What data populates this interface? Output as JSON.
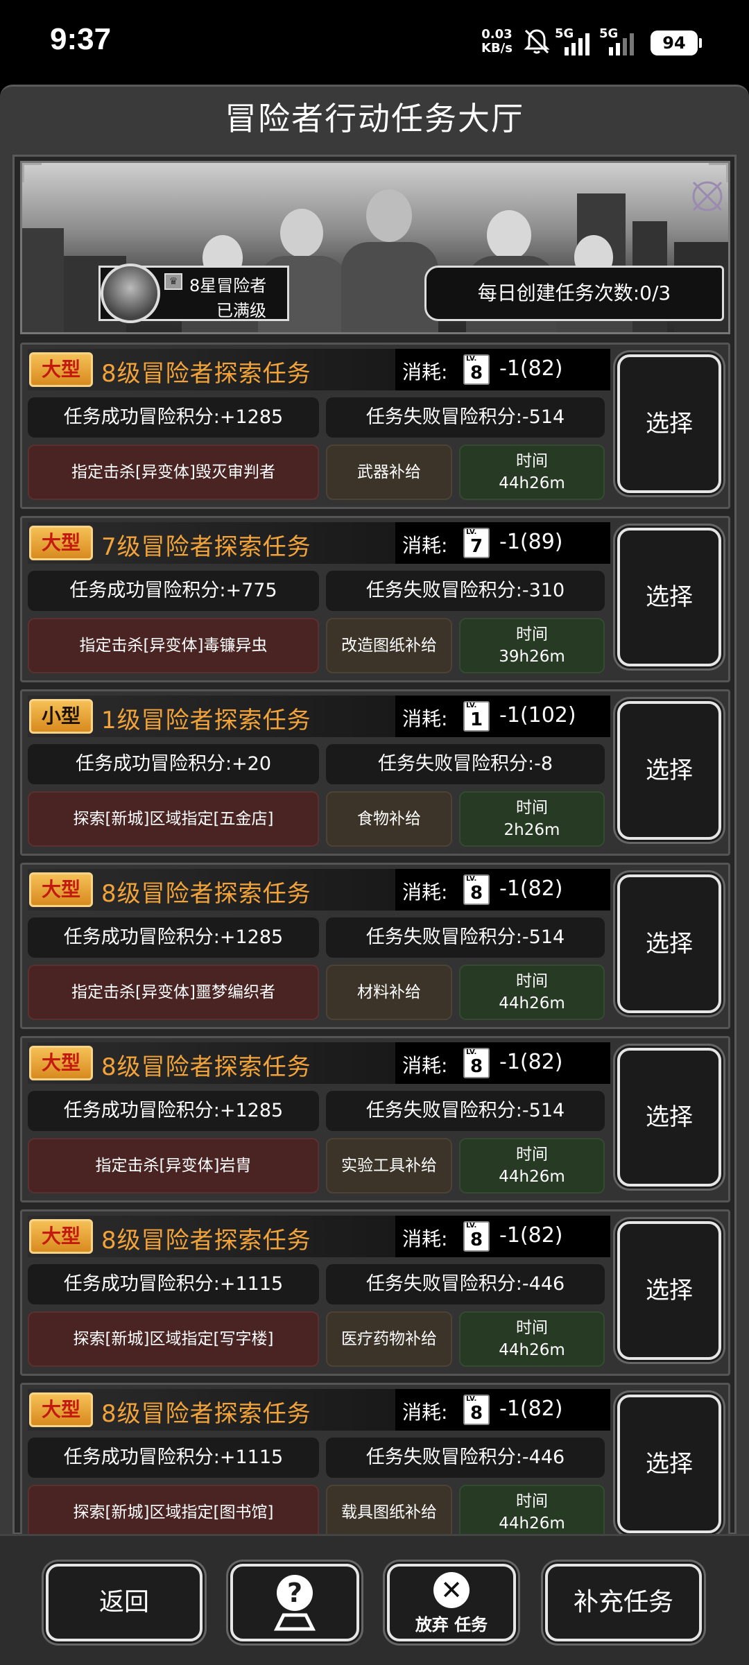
{
  "status_bar": {
    "time": "9:37",
    "speed_value": "0.03",
    "speed_unit": "KB/s",
    "signal1_label": "5G",
    "signal2_label": "5G",
    "battery": "94"
  },
  "panel": {
    "title": "冒险者行动任务大厅"
  },
  "banner": {
    "rank_title": "8星冒险者",
    "rank_status": "已满级",
    "daily_quota": "每日创建任务次数:0/3"
  },
  "common": {
    "cost_label": "消耗:",
    "lv_text": "LV.",
    "time_label": "时间",
    "select_label": "选择"
  },
  "missions": [
    {
      "type": "大型",
      "title": "8级冒险者探索任务",
      "lv": "8",
      "cost": "-1(82)",
      "success": "任务成功冒险积分:+1285",
      "fail": "任务失败冒险积分:-514",
      "target": "指定击杀[异变体]毁灭审判者",
      "supply": "武器补给",
      "time": "44h26m"
    },
    {
      "type": "大型",
      "title": "7级冒险者探索任务",
      "lv": "7",
      "cost": "-1(89)",
      "success": "任务成功冒险积分:+775",
      "fail": "任务失败冒险积分:-310",
      "target": "指定击杀[异变体]毒镰异虫",
      "supply": "改造图纸补给",
      "time": "39h26m"
    },
    {
      "type": "小型",
      "title": "1级冒险者探索任务",
      "lv": "1",
      "cost": "-1(102)",
      "success": "任务成功冒险积分:+20",
      "fail": "任务失败冒险积分:-8",
      "target": "探索[新城]区域指定[五金店]",
      "supply": "食物补给",
      "time": "2h26m"
    },
    {
      "type": "大型",
      "title": "8级冒险者探索任务",
      "lv": "8",
      "cost": "-1(82)",
      "success": "任务成功冒险积分:+1285",
      "fail": "任务失败冒险积分:-514",
      "target": "指定击杀[异变体]噩梦编织者",
      "supply": "材料补给",
      "time": "44h26m"
    },
    {
      "type": "大型",
      "title": "8级冒险者探索任务",
      "lv": "8",
      "cost": "-1(82)",
      "success": "任务成功冒险积分:+1285",
      "fail": "任务失败冒险积分:-514",
      "target": "指定击杀[异变体]岩胄",
      "supply": "实验工具补给",
      "time": "44h26m"
    },
    {
      "type": "大型",
      "title": "8级冒险者探索任务",
      "lv": "8",
      "cost": "-1(82)",
      "success": "任务成功冒险积分:+1115",
      "fail": "任务失败冒险积分:-446",
      "target": "探索[新城]区域指定[写字楼]",
      "supply": "医疗药物补给",
      "time": "44h26m"
    },
    {
      "type": "大型",
      "title": "8级冒险者探索任务",
      "lv": "8",
      "cost": "-1(82)",
      "success": "任务成功冒险积分:+1115",
      "fail": "任务失败冒险积分:-446",
      "target": "探索[新城]区域指定[图书馆]",
      "supply": "载具图纸补给",
      "time": "44h26m"
    }
  ],
  "bottom": {
    "back": "返回",
    "abandon": "放弃 任务",
    "refill": "补充任务"
  },
  "colors": {
    "title_orange": "#f2a33a",
    "badge_gold": "#e3a33c",
    "badge_red_text": "#c21a0f",
    "target_bg": "#4a2323",
    "supply_bg": "#3c3429",
    "time_bg": "#263a24"
  }
}
